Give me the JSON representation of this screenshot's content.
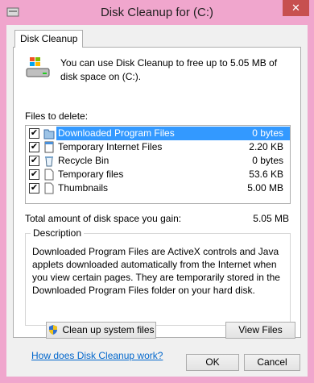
{
  "window": {
    "title": "Disk Cleanup for  (C:)",
    "close_glyph": "✕"
  },
  "tab": {
    "label": "Disk Cleanup"
  },
  "intro": {
    "text": "You can use Disk Cleanup to free up to 5.05 MB of disk space on  (C:)."
  },
  "files": {
    "label": "Files to delete:",
    "items": [
      {
        "name": "Downloaded Program Files",
        "size": "0 bytes",
        "checked": true,
        "icon": "folder-icon"
      },
      {
        "name": "Temporary Internet Files",
        "size": "2.20 KB",
        "checked": true,
        "icon": "document-icon"
      },
      {
        "name": "Recycle Bin",
        "size": "0 bytes",
        "checked": true,
        "icon": "recycle-bin-icon"
      },
      {
        "name": "Temporary files",
        "size": "53.6 KB",
        "checked": true,
        "icon": "file-icon"
      },
      {
        "name": "Thumbnails",
        "size": "5.00 MB",
        "checked": true,
        "icon": "file-icon"
      }
    ]
  },
  "total": {
    "label": "Total amount of disk space you gain:",
    "value": "5.05 MB"
  },
  "description": {
    "legend": "Description",
    "text": "Downloaded Program Files are ActiveX controls and Java applets downloaded automatically from the Internet when you view certain pages. They are temporarily stored in the Downloaded Program Files folder on your hard disk."
  },
  "buttons": {
    "cleanup": "Clean up system files",
    "view_files": "View Files",
    "ok": "OK",
    "cancel": "Cancel"
  },
  "help_link": "How does Disk Cleanup work?",
  "colors": {
    "frame": "#f0a6cd",
    "selection": "#3399ff",
    "link": "#0066cc",
    "close_button": "#c7504f"
  }
}
